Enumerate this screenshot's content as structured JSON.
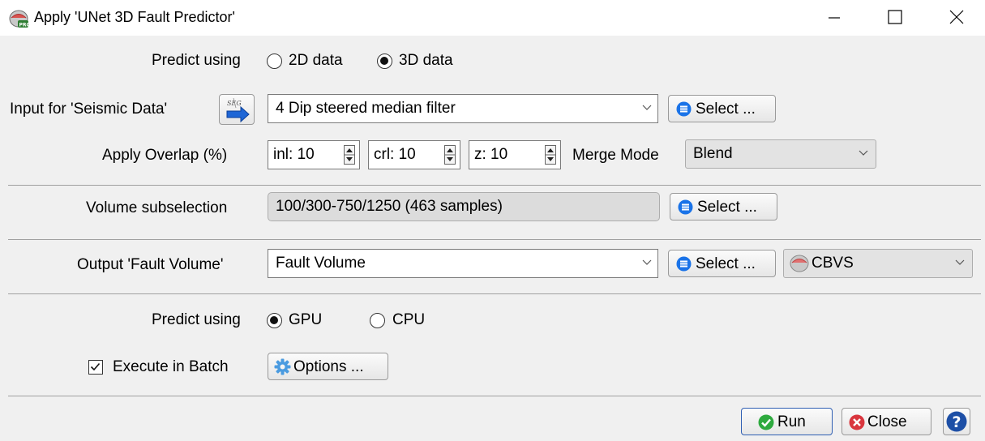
{
  "window": {
    "title": "Apply 'UNet 3D Fault Predictor'",
    "icon": "app-logo-icon"
  },
  "predict_data": {
    "label": "Predict using",
    "options": [
      "2D data",
      "3D data"
    ],
    "selected": "3D data"
  },
  "input": {
    "label": "Input for 'Seismic Data'",
    "icon": "segy-import-icon",
    "value": "4 Dip steered median filter",
    "select_label": "Select ..."
  },
  "overlap": {
    "label": "Apply Overlap (%)",
    "inl": "inl: 10",
    "crl": "crl: 10",
    "z": "z: 10",
    "merge_label": "Merge Mode",
    "merge_value": "Blend"
  },
  "volume": {
    "label": "Volume subselection",
    "value": "100/300-750/1250 (463 samples)",
    "select_label": "Select ..."
  },
  "output": {
    "label": "Output 'Fault Volume'",
    "value": "Fault Volume",
    "select_label": "Select ...",
    "format": "CBVS"
  },
  "predict_device": {
    "label": "Predict using",
    "options": [
      "GPU",
      "CPU"
    ],
    "selected": "GPU"
  },
  "batch": {
    "label": "Execute in Batch",
    "checked": true,
    "options_label": "Options ..."
  },
  "footer": {
    "run_label": "Run",
    "close_label": "Close"
  },
  "colors": {
    "accent_blue": "#1a73e8",
    "run_green": "#2eaa3f",
    "close_red": "#d9363e",
    "help_blue": "#1d4fa6"
  }
}
